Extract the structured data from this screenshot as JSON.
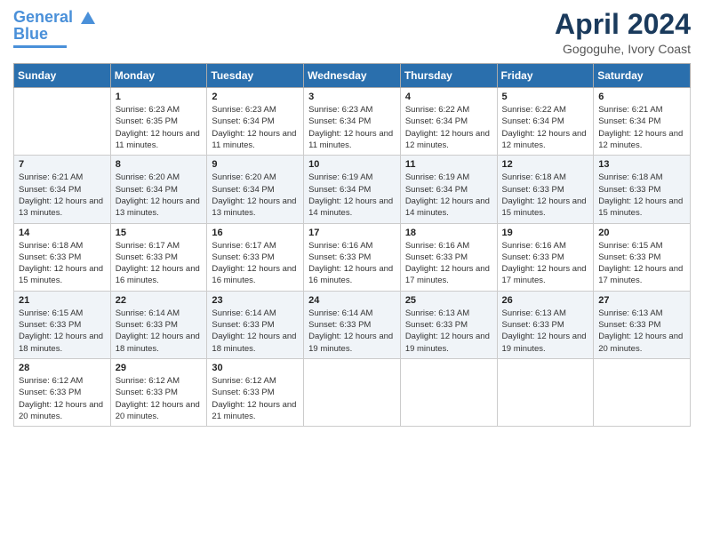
{
  "header": {
    "logo_line1": "General",
    "logo_line2": "Blue",
    "title": "April 2024",
    "subtitle": "Gogoguhe, Ivory Coast"
  },
  "weekdays": [
    "Sunday",
    "Monday",
    "Tuesday",
    "Wednesday",
    "Thursday",
    "Friday",
    "Saturday"
  ],
  "weeks": [
    [
      {
        "day": "",
        "sunrise": "",
        "sunset": "",
        "daylight": ""
      },
      {
        "day": "1",
        "sunrise": "Sunrise: 6:23 AM",
        "sunset": "Sunset: 6:35 PM",
        "daylight": "Daylight: 12 hours and 11 minutes."
      },
      {
        "day": "2",
        "sunrise": "Sunrise: 6:23 AM",
        "sunset": "Sunset: 6:34 PM",
        "daylight": "Daylight: 12 hours and 11 minutes."
      },
      {
        "day": "3",
        "sunrise": "Sunrise: 6:23 AM",
        "sunset": "Sunset: 6:34 PM",
        "daylight": "Daylight: 12 hours and 11 minutes."
      },
      {
        "day": "4",
        "sunrise": "Sunrise: 6:22 AM",
        "sunset": "Sunset: 6:34 PM",
        "daylight": "Daylight: 12 hours and 12 minutes."
      },
      {
        "day": "5",
        "sunrise": "Sunrise: 6:22 AM",
        "sunset": "Sunset: 6:34 PM",
        "daylight": "Daylight: 12 hours and 12 minutes."
      },
      {
        "day": "6",
        "sunrise": "Sunrise: 6:21 AM",
        "sunset": "Sunset: 6:34 PM",
        "daylight": "Daylight: 12 hours and 12 minutes."
      }
    ],
    [
      {
        "day": "7",
        "sunrise": "Sunrise: 6:21 AM",
        "sunset": "Sunset: 6:34 PM",
        "daylight": "Daylight: 12 hours and 13 minutes."
      },
      {
        "day": "8",
        "sunrise": "Sunrise: 6:20 AM",
        "sunset": "Sunset: 6:34 PM",
        "daylight": "Daylight: 12 hours and 13 minutes."
      },
      {
        "day": "9",
        "sunrise": "Sunrise: 6:20 AM",
        "sunset": "Sunset: 6:34 PM",
        "daylight": "Daylight: 12 hours and 13 minutes."
      },
      {
        "day": "10",
        "sunrise": "Sunrise: 6:19 AM",
        "sunset": "Sunset: 6:34 PM",
        "daylight": "Daylight: 12 hours and 14 minutes."
      },
      {
        "day": "11",
        "sunrise": "Sunrise: 6:19 AM",
        "sunset": "Sunset: 6:34 PM",
        "daylight": "Daylight: 12 hours and 14 minutes."
      },
      {
        "day": "12",
        "sunrise": "Sunrise: 6:18 AM",
        "sunset": "Sunset: 6:33 PM",
        "daylight": "Daylight: 12 hours and 15 minutes."
      },
      {
        "day": "13",
        "sunrise": "Sunrise: 6:18 AM",
        "sunset": "Sunset: 6:33 PM",
        "daylight": "Daylight: 12 hours and 15 minutes."
      }
    ],
    [
      {
        "day": "14",
        "sunrise": "Sunrise: 6:18 AM",
        "sunset": "Sunset: 6:33 PM",
        "daylight": "Daylight: 12 hours and 15 minutes."
      },
      {
        "day": "15",
        "sunrise": "Sunrise: 6:17 AM",
        "sunset": "Sunset: 6:33 PM",
        "daylight": "Daylight: 12 hours and 16 minutes."
      },
      {
        "day": "16",
        "sunrise": "Sunrise: 6:17 AM",
        "sunset": "Sunset: 6:33 PM",
        "daylight": "Daylight: 12 hours and 16 minutes."
      },
      {
        "day": "17",
        "sunrise": "Sunrise: 6:16 AM",
        "sunset": "Sunset: 6:33 PM",
        "daylight": "Daylight: 12 hours and 16 minutes."
      },
      {
        "day": "18",
        "sunrise": "Sunrise: 6:16 AM",
        "sunset": "Sunset: 6:33 PM",
        "daylight": "Daylight: 12 hours and 17 minutes."
      },
      {
        "day": "19",
        "sunrise": "Sunrise: 6:16 AM",
        "sunset": "Sunset: 6:33 PM",
        "daylight": "Daylight: 12 hours and 17 minutes."
      },
      {
        "day": "20",
        "sunrise": "Sunrise: 6:15 AM",
        "sunset": "Sunset: 6:33 PM",
        "daylight": "Daylight: 12 hours and 17 minutes."
      }
    ],
    [
      {
        "day": "21",
        "sunrise": "Sunrise: 6:15 AM",
        "sunset": "Sunset: 6:33 PM",
        "daylight": "Daylight: 12 hours and 18 minutes."
      },
      {
        "day": "22",
        "sunrise": "Sunrise: 6:14 AM",
        "sunset": "Sunset: 6:33 PM",
        "daylight": "Daylight: 12 hours and 18 minutes."
      },
      {
        "day": "23",
        "sunrise": "Sunrise: 6:14 AM",
        "sunset": "Sunset: 6:33 PM",
        "daylight": "Daylight: 12 hours and 18 minutes."
      },
      {
        "day": "24",
        "sunrise": "Sunrise: 6:14 AM",
        "sunset": "Sunset: 6:33 PM",
        "daylight": "Daylight: 12 hours and 19 minutes."
      },
      {
        "day": "25",
        "sunrise": "Sunrise: 6:13 AM",
        "sunset": "Sunset: 6:33 PM",
        "daylight": "Daylight: 12 hours and 19 minutes."
      },
      {
        "day": "26",
        "sunrise": "Sunrise: 6:13 AM",
        "sunset": "Sunset: 6:33 PM",
        "daylight": "Daylight: 12 hours and 19 minutes."
      },
      {
        "day": "27",
        "sunrise": "Sunrise: 6:13 AM",
        "sunset": "Sunset: 6:33 PM",
        "daylight": "Daylight: 12 hours and 20 minutes."
      }
    ],
    [
      {
        "day": "28",
        "sunrise": "Sunrise: 6:12 AM",
        "sunset": "Sunset: 6:33 PM",
        "daylight": "Daylight: 12 hours and 20 minutes."
      },
      {
        "day": "29",
        "sunrise": "Sunrise: 6:12 AM",
        "sunset": "Sunset: 6:33 PM",
        "daylight": "Daylight: 12 hours and 20 minutes."
      },
      {
        "day": "30",
        "sunrise": "Sunrise: 6:12 AM",
        "sunset": "Sunset: 6:33 PM",
        "daylight": "Daylight: 12 hours and 21 minutes."
      },
      {
        "day": "",
        "sunrise": "",
        "sunset": "",
        "daylight": ""
      },
      {
        "day": "",
        "sunrise": "",
        "sunset": "",
        "daylight": ""
      },
      {
        "day": "",
        "sunrise": "",
        "sunset": "",
        "daylight": ""
      },
      {
        "day": "",
        "sunrise": "",
        "sunset": "",
        "daylight": ""
      }
    ]
  ]
}
